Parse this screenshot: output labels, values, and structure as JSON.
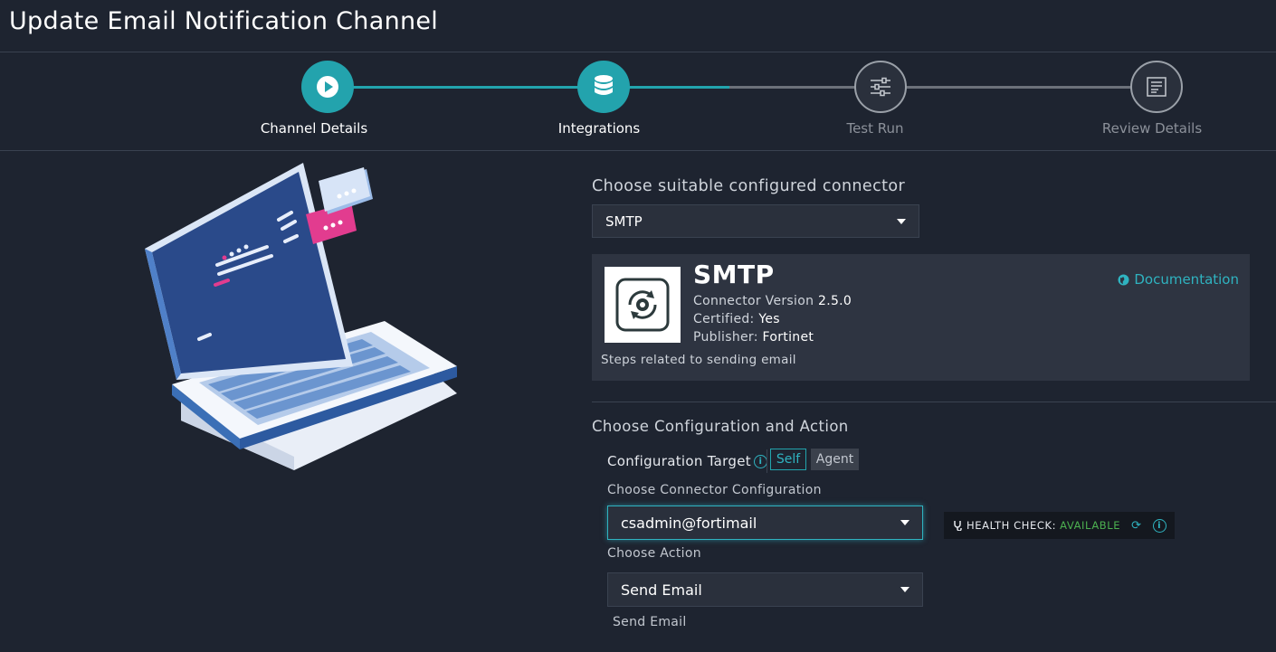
{
  "page": {
    "title": "Update Email Notification Channel"
  },
  "wizard": {
    "steps": [
      {
        "label": "Channel Details",
        "icon": "play-icon",
        "state": "complete"
      },
      {
        "label": "Integrations",
        "icon": "database-icon",
        "state": "active"
      },
      {
        "label": "Test Run",
        "icon": "sliders-icon",
        "state": "pending"
      },
      {
        "label": "Review Details",
        "icon": "document-icon",
        "state": "pending"
      }
    ]
  },
  "connector": {
    "section_title": "Choose suitable configured connector",
    "selected": "SMTP",
    "card": {
      "name": "SMTP",
      "version_label": "Connector Version",
      "version": "2.5.0",
      "certified_label": "Certified:",
      "certified": "Yes",
      "publisher_label": "Publisher:",
      "publisher": "Fortinet",
      "description": "Steps related to sending email",
      "doc_link": "Documentation"
    }
  },
  "configuration": {
    "section_title": "Choose Configuration and Action",
    "target_label": "Configuration Target",
    "target_options": [
      "Self",
      "Agent"
    ],
    "target_selected": "Self",
    "connector_config_label": "Choose Connector Configuration",
    "connector_config_value": "csadmin@fortimail",
    "health_label": "HEALTH CHECK:",
    "health_status": "AVAILABLE",
    "action_label": "Choose Action",
    "action_value": "Send Email",
    "action_description": "Send Email"
  },
  "colors": {
    "accent": "#22a4ad",
    "background": "#1e2430",
    "health_ok": "#4cb050"
  }
}
